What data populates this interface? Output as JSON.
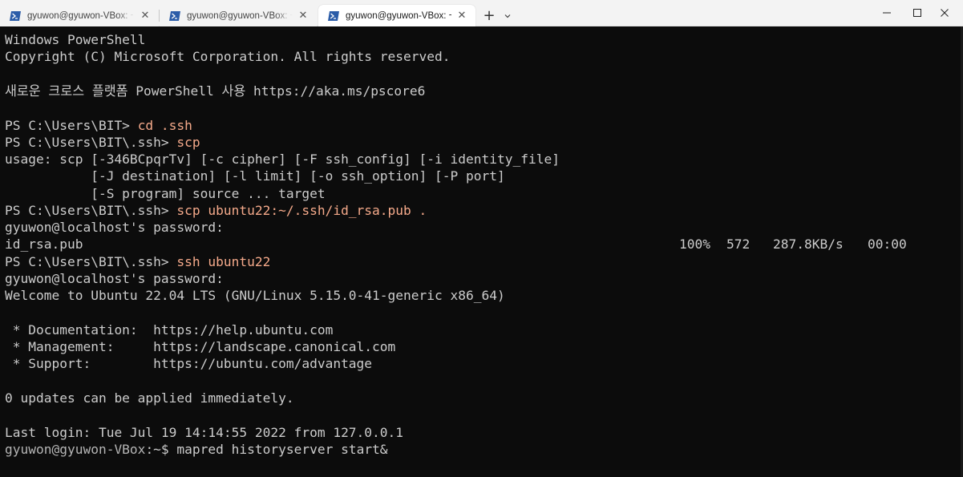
{
  "tabs": [
    {
      "title": "gyuwon@gyuwon-VBox: ~/ha",
      "active": false
    },
    {
      "title": "gyuwon@gyuwon-VBox: ~/da",
      "active": false
    },
    {
      "title": "gyuwon@gyuwon-VBox: ~",
      "active": true
    }
  ],
  "tab_controls": {
    "close_glyph": "✕",
    "new_tab_glyph": "+"
  },
  "icons": {
    "tab_icon": "powershell-icon",
    "dropdown": "chevron-down-icon",
    "minimize": "minimize-icon",
    "maximize": "maximize-icon",
    "close": "close-icon"
  },
  "colors": {
    "terminal_bg": "#0c0c0c",
    "terminal_fg": "#cccccc",
    "command": "#f4a98a",
    "tabbar_bg": "#f3f3f3",
    "ps_icon": "#2b5ca8"
  },
  "terminal": {
    "header": {
      "title": "Windows PowerShell",
      "copyright": "Copyright (C) Microsoft Corporation. All rights reserved.",
      "promo": "새로운 크로스 플랫폼 PowerShell 사용 https://aka.ms/pscore6"
    },
    "ps_prompt_1": "PS C:\\Users\\BIT> ",
    "cmd_1": "cd .ssh",
    "ps_prompt_2": "PS C:\\Users\\BIT\\.ssh> ",
    "cmd_2": "scp",
    "usage_1": "usage: scp [-346BCpqrTv] [-c cipher] [-F ssh_config] [-i identity_file]",
    "usage_2": "           [-J destination] [-l limit] [-o ssh_option] [-P port]",
    "usage_3": "           [-S program] source ... target",
    "ps_prompt_3": "PS C:\\Users\\BIT\\.ssh> ",
    "cmd_3": "scp ubuntu22:~/.ssh/id_rsa.pub .",
    "password_prompt_1": "gyuwon@localhost's password:",
    "transfer": {
      "file": "id_rsa.pub",
      "percent": "100%",
      "size": "572",
      "speed": "287.8KB/s",
      "eta": "00:00"
    },
    "ps_prompt_4": "PS C:\\Users\\BIT\\.ssh> ",
    "cmd_4": "ssh ubuntu22",
    "password_prompt_2": "gyuwon@localhost's password:",
    "welcome": "Welcome to Ubuntu 22.04 LTS (GNU/Linux 5.15.0-41-generic x86_64)",
    "doc_line": " * Documentation:  https://help.ubuntu.com",
    "mgmt_line": " * Management:     https://landscape.canonical.com",
    "support_line": " * Support:        https://ubuntu.com/advantage",
    "updates": "0 updates can be applied immediately.",
    "last_login": "Last login: Tue Jul 19 14:14:55 2022 from 127.0.0.1",
    "bash_user": "gyuwon@gyuwon-VBox",
    "bash_path": ":~$ ",
    "cmd_5": "mapred historyserver start&"
  }
}
